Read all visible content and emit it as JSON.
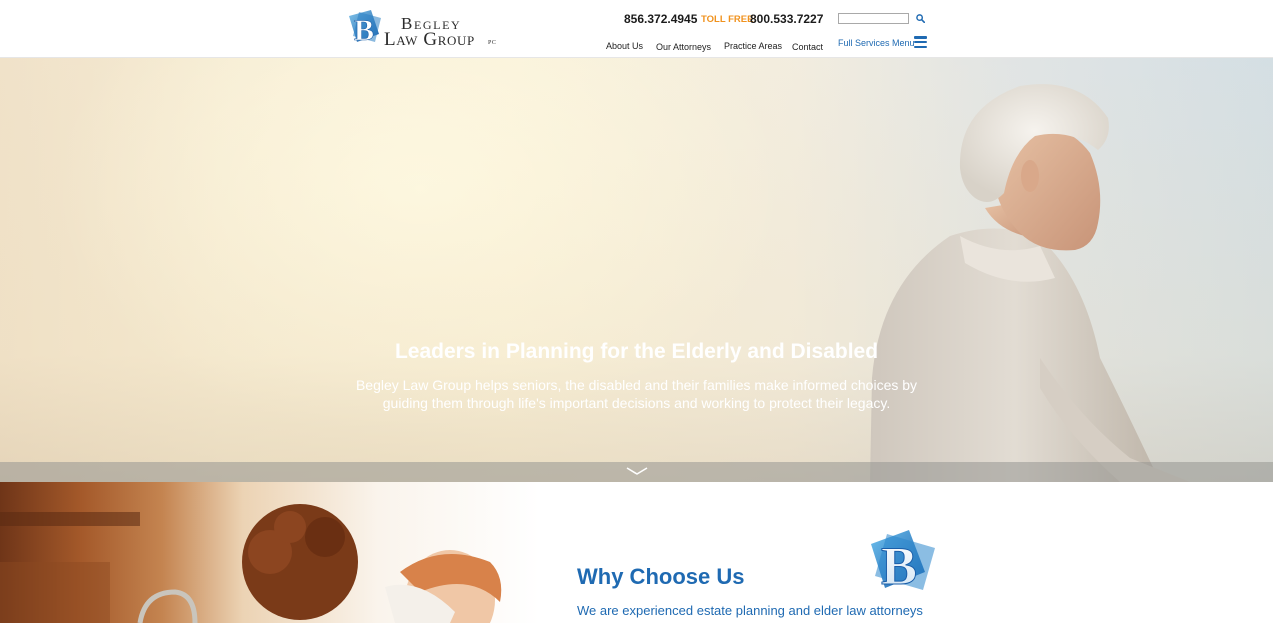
{
  "header": {
    "logo": {
      "line1": "Begley",
      "line2": "Law Group",
      "suffix": "PC"
    },
    "phone_main": "856.372.4945",
    "toll_free_label": "TOLL FREE:",
    "phone_toll_free": "800.533.7227",
    "search": {
      "value": "",
      "placeholder": ""
    },
    "nav": {
      "about": "About Us",
      "attorneys": "Our Attorneys",
      "practice": "Practice Areas",
      "contact": "Contact"
    },
    "full_menu": "Full Services Menu"
  },
  "hero": {
    "title": "Leaders in Planning for the Elderly and Disabled",
    "subtitle": "Begley Law Group helps seniors, the disabled and their families make informed choices by guiding them through life's important decisions and working to protect their legacy."
  },
  "why": {
    "heading": "Why Choose Us",
    "subheading": "We are experienced estate planning and elder law attorneys"
  },
  "colors": {
    "brand_blue": "#1f6ab2",
    "accent_orange": "#f0921e",
    "text_dark": "#1b1b1b"
  },
  "icons": {
    "search": "search-icon",
    "menu": "hamburger-menu-icon",
    "scroll": "chevron-down-icon"
  }
}
